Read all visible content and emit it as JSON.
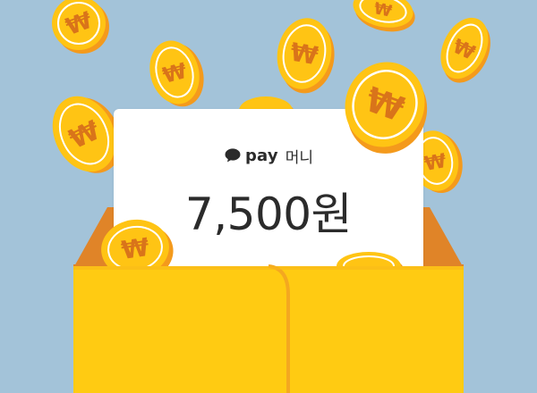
{
  "card": {
    "brand_name": "pay",
    "brand_label": "머니",
    "amount": "7,500원"
  },
  "coin_symbol": "₩",
  "colors": {
    "background": "#a3c3d9",
    "envelope": "#ffcb12",
    "envelope_back": "#e08428",
    "coin_face": "#ffc414",
    "coin_edge": "#f49a1c",
    "coin_ring": "#ffffff",
    "coin_symbol": "#d9741a",
    "card": "#ffffff",
    "text": "#2b2b2b"
  },
  "icons": {
    "brand": "speech-bubble-icon"
  }
}
